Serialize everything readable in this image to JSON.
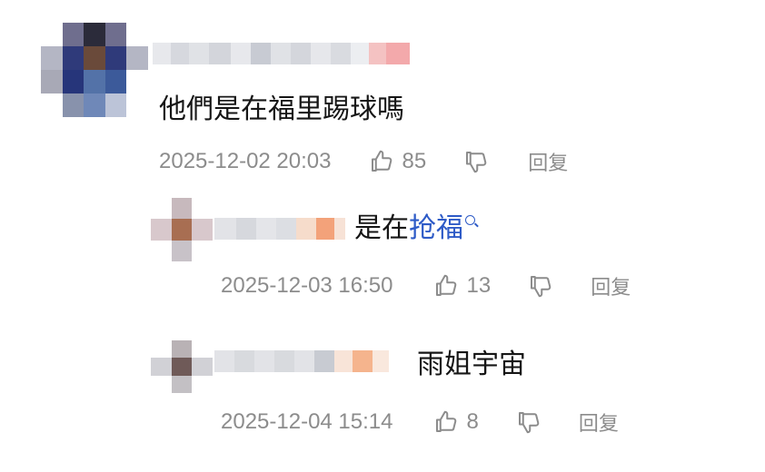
{
  "comments": [
    {
      "text": "他們是在福里踢球嗎",
      "timestamp": "2025-12-02 20:03",
      "likes": "85",
      "reply_label": "回复"
    },
    {
      "text_prefix": "是在",
      "text_link": "抢福",
      "timestamp": "2025-12-03 16:50",
      "likes": "13",
      "reply_label": "回复"
    },
    {
      "text": "雨姐宇宙",
      "timestamp": "2025-12-04 15:14",
      "likes": "8",
      "reply_label": "回复"
    }
  ],
  "icons": {
    "like": "thumbs-up-icon",
    "dislike": "thumbs-down-icon",
    "search": "search-icon"
  },
  "colors": {
    "link": "#2e5bc7",
    "meta_text": "#8c8c8c",
    "body_text": "#161616"
  }
}
